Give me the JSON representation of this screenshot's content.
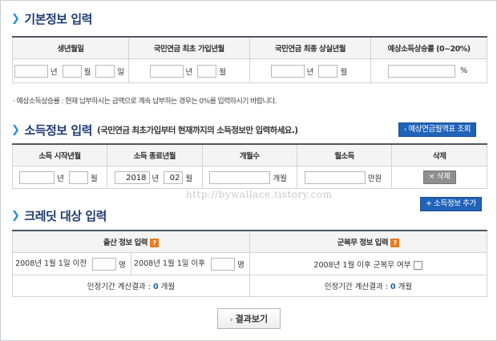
{
  "basic": {
    "title": "기본정보 입력",
    "headers": [
      "생년월일",
      "국민연금 최초 가입년월",
      "국민연금 최종 상실년월",
      "예상소득상승률 (0~20%)"
    ],
    "year": "년",
    "month": "월",
    "day": "일",
    "percent": "%"
  },
  "note": "· 예상소득상승률 : 현재 납부하시는 금액으로 계속 납부하는 경우는 0%를 입력하시기 바랍니다.",
  "income": {
    "title": "소득정보 입력",
    "subtitle": "(국민연금 최초가입부터 현재까지의 소득정보만 입력하세요.)",
    "lookup_button": "예상연금월액표 조회",
    "headers": [
      "소득 시작년월",
      "소득 종료년월",
      "개월수",
      "월소득",
      "삭제"
    ],
    "end_year": "2018",
    "end_month": "02",
    "year": "년",
    "month": "월",
    "months_unit": "개월",
    "income_unit": "만원",
    "delete_button": "× 삭제",
    "add_button": "+ 소득정보 추가"
  },
  "watermark": "http://bywallace.tistory.com",
  "credit": {
    "title": "크레딧 대상 입력",
    "birth_header": "출산 정보 입력",
    "military_header": "군복무 정보 입력",
    "help_icon": "?",
    "birth_before": "2008년 1월 1일 이전",
    "birth_after": "2008년 1월 1일 이후",
    "person_unit": "명",
    "military_question": "2008년 1월 이후 군복무 여부",
    "recognized_prefix": "인정기간 계산결과 : ",
    "birth_months": "0",
    "military_months": "0",
    "months_unit": "개월"
  },
  "result_button": "결과보기"
}
